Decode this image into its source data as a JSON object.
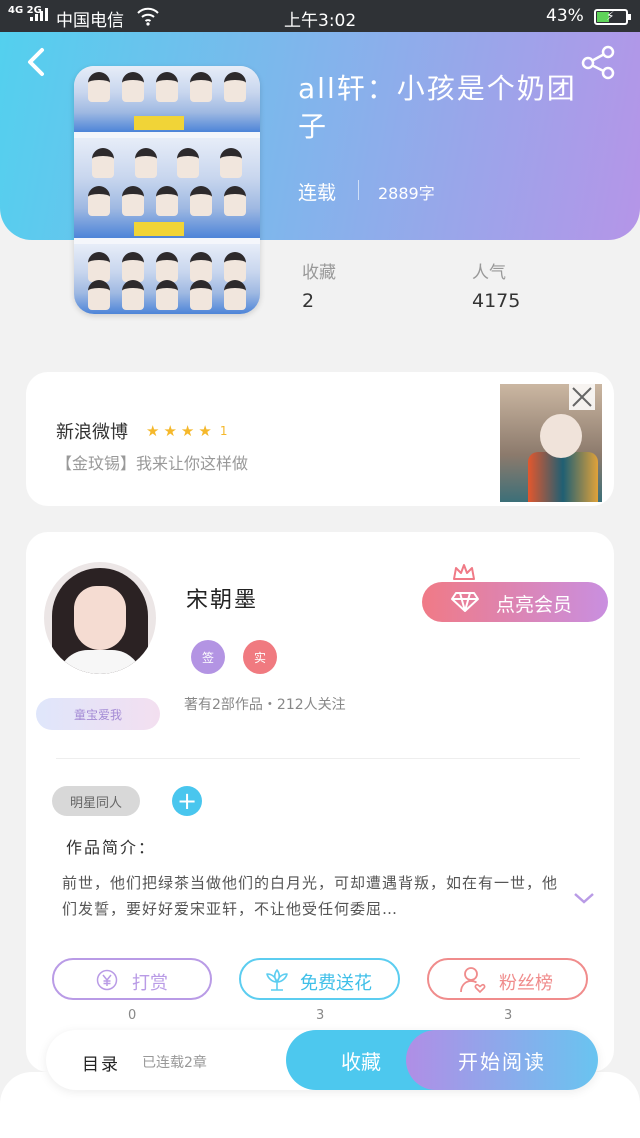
{
  "status_bar": {
    "signal": "4G 2G",
    "carrier": "中国电信",
    "time": "上午3:02",
    "battery": "43%",
    "battery_level": 0.43
  },
  "book": {
    "title": "all轩：小孩是个奶团子",
    "status": "连载",
    "word_count": "2889字",
    "stats": [
      {
        "label": "收藏",
        "value": "2"
      },
      {
        "label": "人气",
        "value": "4175"
      }
    ]
  },
  "ad": {
    "name": "新浪微博",
    "rating_stars": 4,
    "rating": "1",
    "desc": "【金玟锡】我来让你这样做"
  },
  "author": {
    "name": "宋朝墨",
    "badges": [
      {
        "text": "签",
        "color": "#b394e3"
      },
      {
        "text": "实",
        "color": "#f07a80"
      }
    ],
    "fan_tag": "童宝爱我",
    "works_info": "著有2部作品・212人关注",
    "vip_label": "点亮会员"
  },
  "tag": "明星同人",
  "intro": {
    "heading": "作品简介：",
    "text": "前世，他们把绿茶当做他们的白月光，可却遭遇背叛，如在有一世，他们发誓，要好好爱宋亚轩，不让他受任何委屈…"
  },
  "actions": [
    {
      "label": "打赏",
      "count": "0",
      "color": "#b99be6"
    },
    {
      "label": "免费送花",
      "count": "3",
      "color": "#5ccdf0"
    },
    {
      "label": "粉丝榜",
      "count": "3",
      "color": "#f08c8c"
    }
  ],
  "bottom_bar": {
    "toc": "目录",
    "chapters": "已连载2章",
    "favorite": "收藏",
    "read": "开始阅读"
  }
}
